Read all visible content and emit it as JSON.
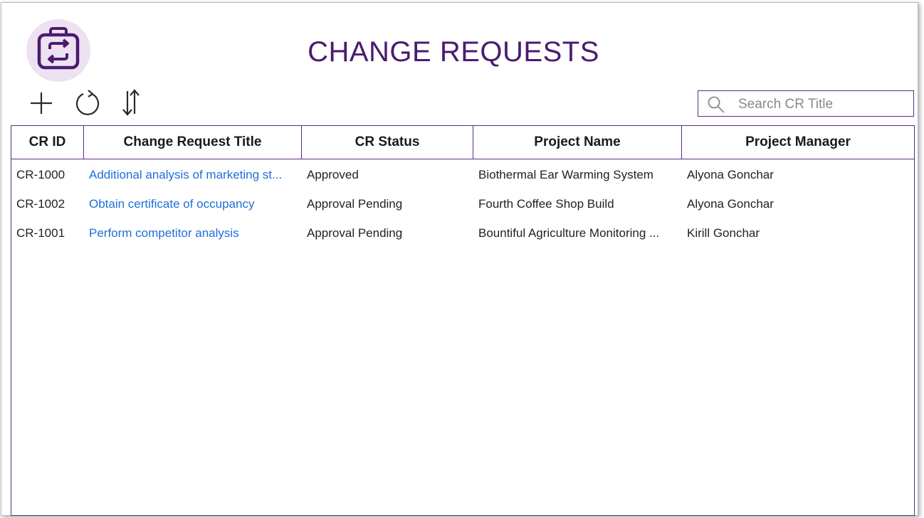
{
  "header": {
    "title": "CHANGE REQUESTS",
    "logo_icon": "briefcase-swap-icon"
  },
  "toolbar": {
    "add_icon": "plus-icon",
    "refresh_icon": "refresh-icon",
    "sort_icon": "sort-icon"
  },
  "search": {
    "placeholder": "Search CR Title",
    "value": "",
    "icon": "search-icon"
  },
  "table": {
    "columns": [
      "CR ID",
      "Change Request Title",
      "CR Status",
      "Project Name",
      "Project Manager"
    ],
    "rows": [
      [
        "CR-1000",
        "Additional analysis of marketing st...",
        "Approved",
        "Biothermal Ear Warming System",
        "Alyona Gonchar"
      ],
      [
        "CR-1002",
        "Obtain certificate of occupancy",
        "Approval Pending",
        "Fourth Coffee Shop Build",
        "Alyona Gonchar"
      ],
      [
        "CR-1001",
        "Perform competitor analysis",
        "Approval Pending",
        "Bountiful Agriculture Monitoring ...",
        "Kirill Gonchar"
      ]
    ]
  },
  "colors": {
    "accent": "#4b1b70",
    "border": "#5a2d81",
    "link": "#1e6fd9",
    "logo_bg": "#ede2f1"
  }
}
